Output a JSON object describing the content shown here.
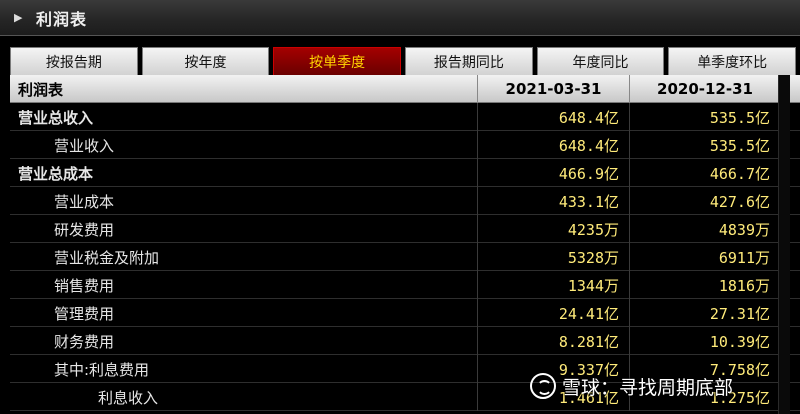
{
  "panel": {
    "title": "利润表",
    "collapse_icon": "triangle-right-icon"
  },
  "tabs": [
    {
      "label": "按报告期",
      "active": false
    },
    {
      "label": "按年度",
      "active": false
    },
    {
      "label": "按单季度",
      "active": true
    },
    {
      "label": "报告期同比",
      "active": false
    },
    {
      "label": "年度同比",
      "active": false
    },
    {
      "label": "单季度环比",
      "active": false
    }
  ],
  "table": {
    "header": {
      "label": "利润表",
      "col1": "2021-03-31",
      "col2": "2020-12-31"
    },
    "rows": [
      {
        "label": "营业总收入",
        "v1": "648.4亿",
        "v2": "535.5亿",
        "level": 0
      },
      {
        "label": "营业收入",
        "v1": "648.4亿",
        "v2": "535.5亿",
        "level": 1
      },
      {
        "label": "营业总成本",
        "v1": "466.9亿",
        "v2": "466.7亿",
        "level": 0
      },
      {
        "label": "营业成本",
        "v1": "433.1亿",
        "v2": "427.6亿",
        "level": 1
      },
      {
        "label": "研发费用",
        "v1": "4235万",
        "v2": "4839万",
        "level": 1
      },
      {
        "label": "营业税金及附加",
        "v1": "5328万",
        "v2": "6911万",
        "level": 1
      },
      {
        "label": "销售费用",
        "v1": "1344万",
        "v2": "1816万",
        "level": 1
      },
      {
        "label": "管理费用",
        "v1": "24.41亿",
        "v2": "27.31亿",
        "level": 1
      },
      {
        "label": "财务费用",
        "v1": "8.281亿",
        "v2": "10.39亿",
        "level": 1
      },
      {
        "label": "其中:利息费用",
        "v1": "9.337亿",
        "v2": "7.758亿",
        "level": 1
      },
      {
        "label": "利息收入",
        "v1": "1.461亿",
        "v2": "1.275亿",
        "level": 2
      }
    ]
  },
  "watermark": {
    "text": "雪球：寻找周期底部"
  },
  "colors": {
    "active_tab_bg": "#8b0000",
    "active_tab_text": "#ffd400",
    "value_text": "#ffeb7a"
  }
}
